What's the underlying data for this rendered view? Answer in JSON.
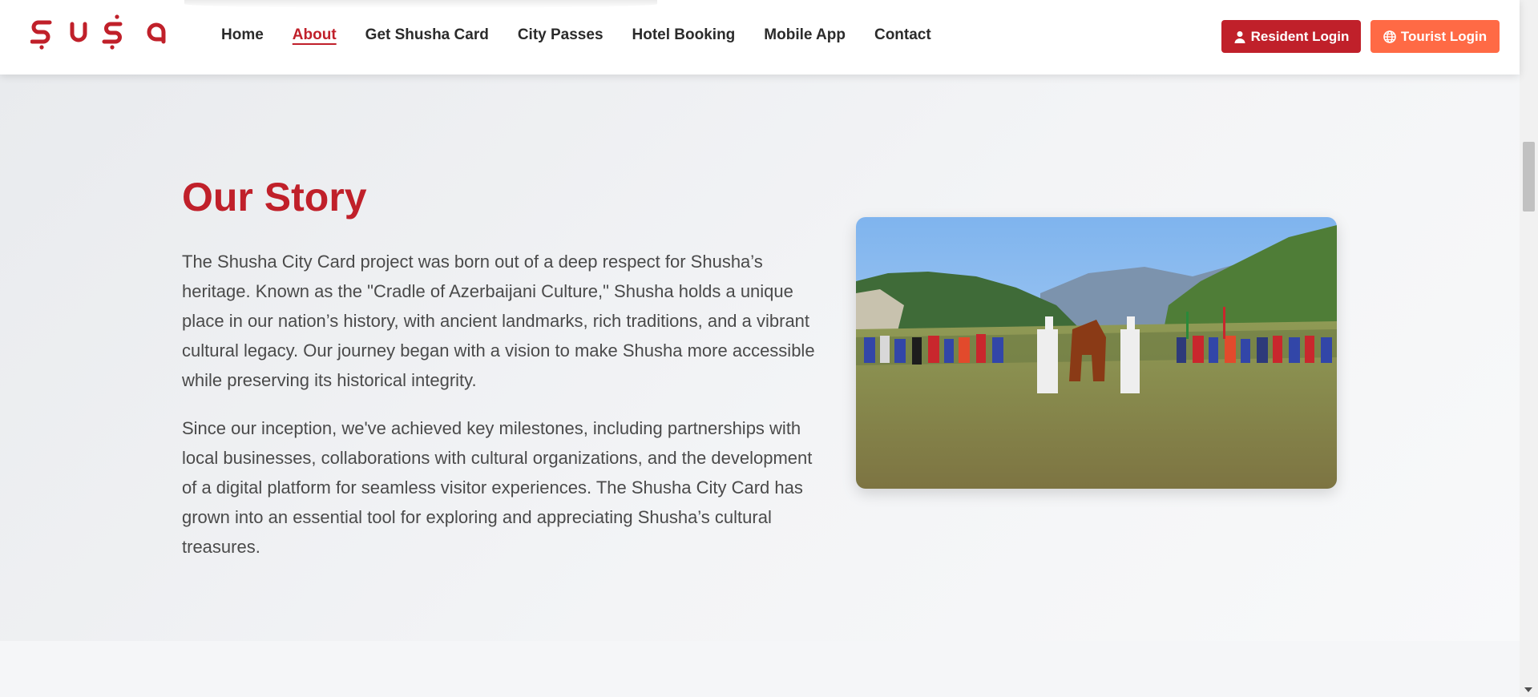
{
  "header": {
    "logo_alt": "Şuşa",
    "nav": [
      {
        "label": "Home",
        "active": false
      },
      {
        "label": "About",
        "active": true
      },
      {
        "label": "Get Shusha Card",
        "active": false
      },
      {
        "label": "City Passes",
        "active": false
      },
      {
        "label": "Hotel Booking",
        "active": false
      },
      {
        "label": "Mobile App",
        "active": false
      },
      {
        "label": "Contact",
        "active": false
      }
    ],
    "resident_login": {
      "label": "Resident Login",
      "icon": "user-icon"
    },
    "tourist_login": {
      "label": "Tourist Login",
      "icon": "globe-icon"
    }
  },
  "story": {
    "title": "Our Story",
    "paragraph_1": "The Shusha City Card project was born out of a deep respect for Shusha’s heritage. Known as the \"Cradle of Azerbaijani Culture,\" Shusha holds a unique place in our nation’s history, with ancient landmarks, rich traditions, and a vibrant cultural legacy. Our journey began with a vision to make Shusha more accessible while preserving its historical integrity.",
    "paragraph_2": "Since our inception, we've achieved key milestones, including partnerships with local businesses, collaborations with cultural organizations, and the development of a digital platform for seamless visitor experiences. The Shusha City Card has grown into an essential tool for exploring and appreciating Shusha’s cultural treasures."
  },
  "colors": {
    "brand_red": "#c0202a",
    "tourist_orange": "#ff6a45",
    "text_dark": "#2b2b2b",
    "text_body": "#4a4a4a"
  }
}
